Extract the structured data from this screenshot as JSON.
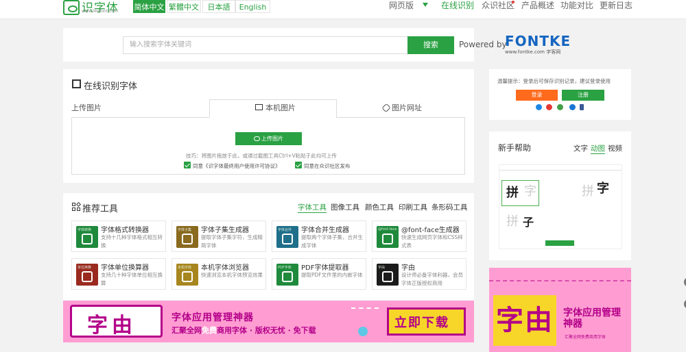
{
  "header": {
    "logo_text": "识字体",
    "logo_url": "www.likefont.com",
    "languages": [
      "简体中文",
      "繁體中文",
      "日本語",
      "English"
    ],
    "nav": [
      "网页版",
      "在线识别",
      "众识社区",
      "产品概述",
      "功能对比",
      "更新日志"
    ]
  },
  "search": {
    "placeholder": "输入搜索字体关键词",
    "button": "搜索",
    "powered_by": "Powered by",
    "brand": "FONTKE",
    "brand_url": "www.fontke.com 字客网"
  },
  "recognize": {
    "title": "在线识别字体",
    "tabs": [
      "上传图片",
      "本机图片",
      "图片网址"
    ],
    "upload_button": "上传图片",
    "tip": "技巧：将图片拖放于此，或通过截图工具Ctrl+V粘贴于此均可上传",
    "agree": "同意《识字体最终用户使用许可协议》",
    "publish": "同意在众识社区发布"
  },
  "tools": {
    "title": "推荐工具",
    "categories": [
      "字体工具",
      "图像工具",
      "颜色工具",
      "印刷工具",
      "条形码工具"
    ],
    "items": [
      {
        "name": "字体格式转换器",
        "desc": "支持十几种字体格式相互转换",
        "icon_label": "字体转换",
        "color": "#1f8a3c"
      },
      {
        "name": "字体子集生成器",
        "desc": "提取字体子集字符，生成精简字体",
        "icon_label": "字体子集",
        "color": "#8a6a1f"
      },
      {
        "name": "字体合并生成器",
        "desc": "提取两个字体子集，合并生成字体",
        "icon_label": "字体合并",
        "color": "#1f6f8a"
      },
      {
        "name": "@font-face生成器",
        "desc": "快速生成网页字体和CSS样式表",
        "icon_label": "@font-face",
        "color": "#1f8a3c"
      },
      {
        "name": "字体单位换算器",
        "desc": "支持几十种字体单位相互换算",
        "icon_label": "单位换算",
        "color": "#9a2a1f"
      },
      {
        "name": "本机字体浏览器",
        "desc": "快速浏览本机字体预览效果",
        "icon_label": "本机字体",
        "color": "#a8861f"
      },
      {
        "name": "PDF字体提取器",
        "desc": "提取PDF文件里的内嵌字体",
        "icon_label": "PDF字体",
        "color": "#1f8a3c"
      },
      {
        "name": "字由",
        "desc": "设计师必备字体利器，会员字体正版授权商用",
        "icon_label": "字由",
        "color": "#1b1b1b"
      }
    ]
  },
  "banner_bottom": {
    "logo": "字由",
    "headline": "字体应用管理神器",
    "sub_pre": "汇聚全网",
    "sub_hl": "免费",
    "sub_post": "商用字体 · 版权无忧 · 免下载",
    "cta": "立即下载"
  },
  "sidebar": {
    "notice": "温馨提示：登录后可保存识别记录，建议登录使用",
    "login": "登录",
    "register": "注册",
    "help_title": "新手帮助",
    "help_tabs": [
      "文字",
      "动图",
      "视频"
    ],
    "demo_chars": [
      "拼",
      "字",
      "拼",
      "子"
    ],
    "banner_logo": "字由",
    "banner_title": "字体应用管理神器",
    "banner_sub": "汇聚全网免费商用字体"
  },
  "colors": {
    "accent": "#2aa142",
    "login": "#ff6a1c",
    "banner": "#ff9dd2"
  }
}
